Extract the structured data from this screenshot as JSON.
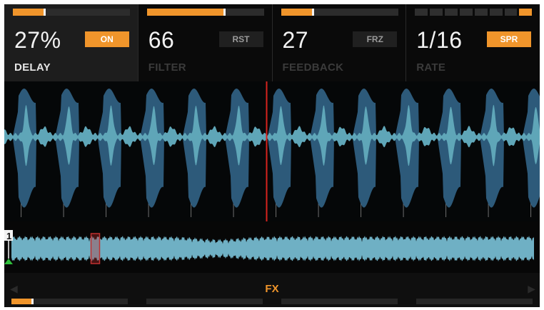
{
  "params": [
    {
      "value": "27%",
      "label": "DELAY",
      "button": "ON",
      "button_active": true,
      "level": 0.27,
      "active": true,
      "meter": "bar"
    },
    {
      "value": "66",
      "label": "FILTER",
      "button": "RST",
      "button_active": false,
      "level": 0.66,
      "active": false,
      "meter": "bar"
    },
    {
      "value": "27",
      "label": "FEEDBACK",
      "button": "FRZ",
      "button_active": false,
      "level": 0.27,
      "active": false,
      "meter": "bar"
    },
    {
      "value": "1/16",
      "label": "RATE",
      "button": "SPR",
      "button_active": true,
      "segments": 8,
      "selected_segment": 7,
      "active": false,
      "meter": "segmented"
    }
  ],
  "waveform": {
    "color": "#5fa6b8",
    "background_color": "#2d5a7a",
    "playhead_color": "#d8231e",
    "playhead_position": 0.49
  },
  "overview": {
    "cue_number": "1",
    "position": 0.17,
    "cue_marker_color": "#2fbf3b"
  },
  "footer": {
    "section_label": "FX",
    "left_arrow": "◀",
    "right_arrow": "▶",
    "bars": [
      0.18,
      0,
      0,
      0
    ]
  },
  "colors": {
    "accent": "#f0952b"
  }
}
